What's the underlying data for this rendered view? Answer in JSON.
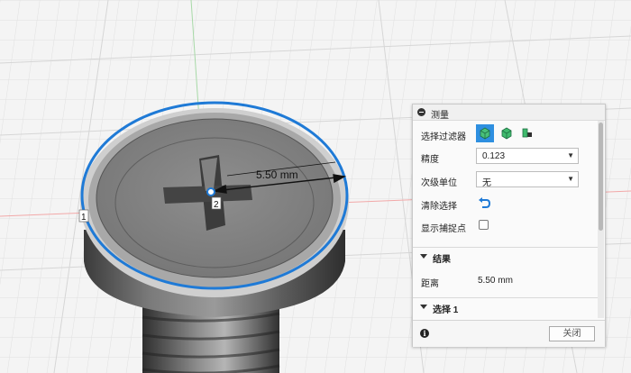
{
  "viewport": {
    "measure_label": "5.50 mm",
    "point1_label": "1",
    "point2_label": "2",
    "accent_color": "#1f7ad6"
  },
  "panel": {
    "title": "测量",
    "selection_filter_label": "选择过滤器",
    "filter_icons": [
      "body-filter-icon",
      "face-filter-icon",
      "edge-vertex-filter-icon"
    ],
    "precision_label": "精度",
    "precision_value": "0.123",
    "secondary_unit_label": "次级单位",
    "secondary_unit_value": "无",
    "clear_selection_label": "清除选择",
    "show_snap_points_label": "显示捕捉点",
    "results_title": "结果",
    "distance_label": "距离",
    "distance_value": "5.50 mm",
    "selection1_title": "选择 1",
    "close_label": "关闭",
    "info_icon": "i"
  }
}
